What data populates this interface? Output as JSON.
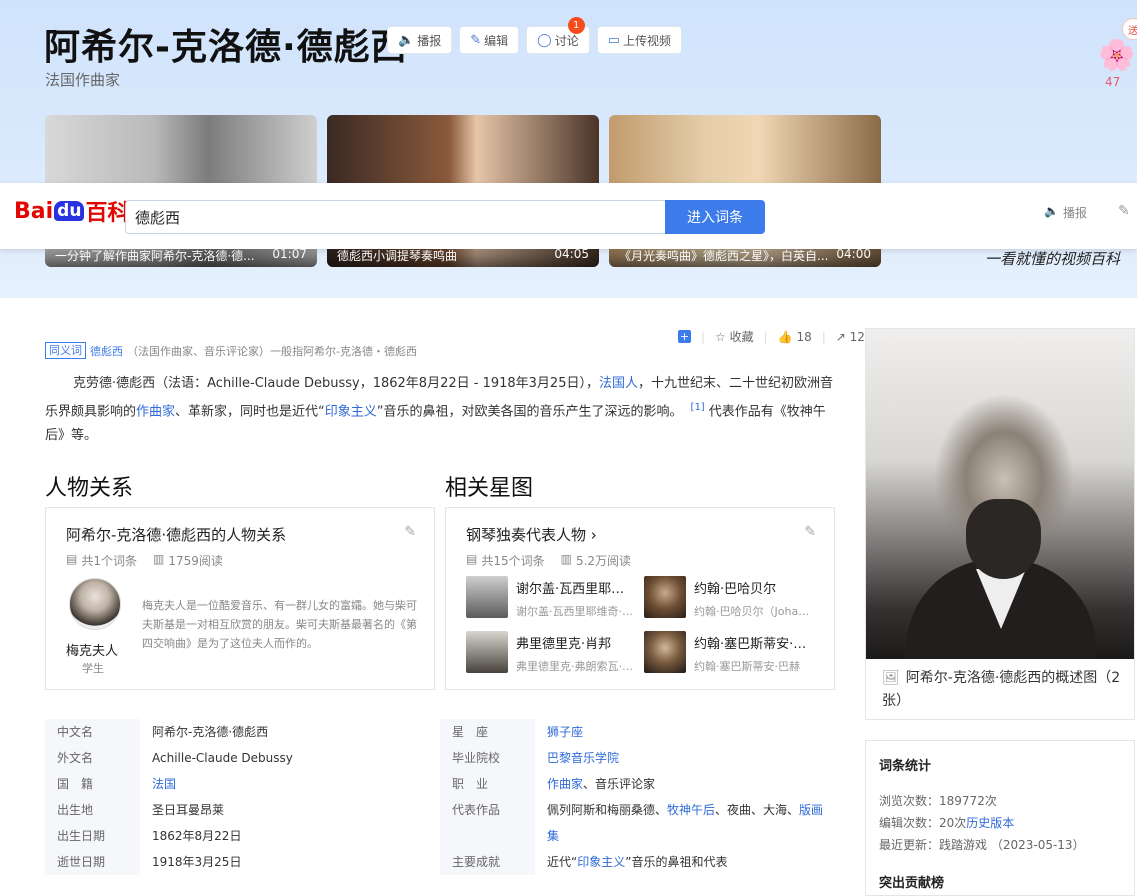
{
  "header": {
    "title": "阿希尔-克洛德·德彪西",
    "subtitle": "法国作曲家",
    "buttons": [
      {
        "icon": "speaker-icon",
        "label": "播报"
      },
      {
        "icon": "pencil-icon",
        "label": "编辑"
      },
      {
        "icon": "chat-icon",
        "label": "讨论",
        "badge": "1"
      },
      {
        "icon": "video-upload-icon",
        "label": "上传视频"
      }
    ],
    "flower_count": "47",
    "corner_tag": "送"
  },
  "videos": [
    {
      "caption": "一分钟了解作曲家阿希尔-克洛德·德...",
      "duration": "01:07"
    },
    {
      "caption": "德彪西小调提琴奏鸣曲",
      "duration": "04:05"
    },
    {
      "caption": "《月光奏鸣曲》德彪西之星》，白英自...",
      "duration": "04:00"
    }
  ],
  "slogan": "一看就懂的视频百科",
  "search": {
    "logo_bai": "Bai",
    "logo_du": "du",
    "logo_baike": "百科",
    "value": "德彪西",
    "button": "进入词条",
    "broadcast": "播报"
  },
  "actions": {
    "favorite": "收藏",
    "likes": "18",
    "shares": "12"
  },
  "synonym": {
    "tag": "同义词",
    "term": "德彪西",
    "note": "（法国作曲家、音乐评论家）一般指阿希尔-克洛德・德彪西"
  },
  "summary": {
    "p1": "克劳德·德彪西（法语：Achille-Claude Debussy，1862年8月22日 - 1918年3月25日），",
    "l1": "法国人",
    "p2": "，十九世纪末、二十世纪初欧洲音乐界颇具影响的",
    "l2": "作曲家",
    "p3": "、革新家，同时也是近代“",
    "l3": "印象主义",
    "p4": "”音乐的鼻祖，对欧美各国的音乐产生了深远的影响。",
    "ref": "[1]",
    "p5": "代表作品有《牧神午后》等。"
  },
  "sections": {
    "relations": "人物关系",
    "stars": "相关星图"
  },
  "relation_card": {
    "title": "阿希尔-克洛德·德彪西的人物关系",
    "entries": "共1个词条",
    "views": "1759阅读",
    "person_name": "梅克夫人",
    "person_role": "学生",
    "person_desc": "梅克夫人是一位酷爱音乐、有一群儿女的富孀。她与柴可夫斯基是一对相互欣赏的朋友。柴可夫斯基最著名的《第四交响曲》是为了这位夫人而作的。"
  },
  "star_card": {
    "title": "钢琴独奏代表人物",
    "entries": "共15个词条",
    "views": "5.2万阅读",
    "items": [
      {
        "name": "谢尔盖·瓦西里耶维奇·拉赫玛尼诺夫",
        "sub": "谢尔盖·瓦西里耶维奇·拉赫玛尼诺夫"
      },
      {
        "name": "约翰·巴哈贝尔",
        "sub": "约翰·巴哈贝尔（Johann Pachelbel）"
      },
      {
        "name": "弗里德里克·肖邦",
        "sub": "弗里德里克·弗朗索瓦·肖邦"
      },
      {
        "name": "约翰·塞巴斯蒂安·巴赫",
        "sub": "约翰·塞巴斯蒂安·巴赫"
      }
    ]
  },
  "info": {
    "rows": [
      {
        "k1": "中文名",
        "v1": "阿希尔-克洛德·德彪西",
        "k2": "星　座",
        "v2": "狮子座",
        "v2_link": true
      },
      {
        "k1": "外文名",
        "v1": "Achille-Claude Debussy",
        "k2": "毕业院校",
        "v2": "巴黎音乐学院",
        "v2_link": true
      },
      {
        "k1": "国　籍",
        "v1": "法国",
        "v1_link": true,
        "k2": "职　业",
        "v2a": "作曲家",
        "v2b": "、音乐评论家"
      },
      {
        "k1": "出生地",
        "v1": "圣日耳曼昂莱",
        "k2": "代表作品",
        "v2c1": "佩列阿斯和梅丽桑德、",
        "v2c2": "牧神午后",
        "v2c3": "、夜曲、大海、",
        "v2c4": "版画"
      },
      {
        "k1": "出生日期",
        "v1": "1862年8月22日",
        "k2": "",
        "v2_cont": "集"
      },
      {
        "k1": "逝世日期",
        "v1": "1918年3月25日",
        "k2": "主要成就",
        "v2d1": "近代“",
        "v2d2": "印象主义",
        "v2d3": "”音乐的鼻祖和代表"
      }
    ]
  },
  "sidebar": {
    "pic_caption": "阿希尔-克洛德·德彪西的概述图（2张）",
    "stats_title": "词条统计",
    "views_label": "浏览次数：",
    "views": "189772次",
    "edits_label": "编辑次数：",
    "edits": "20次",
    "history_link": "历史版本",
    "updated_label": "最近更新：",
    "updated": "践踏游戏 （2023-05-13）",
    "contrib_title": "突出贡献榜"
  },
  "colors": {
    "accent": "#3c7bea",
    "link": "#2f6ad8",
    "badge": "#f54b1d"
  }
}
